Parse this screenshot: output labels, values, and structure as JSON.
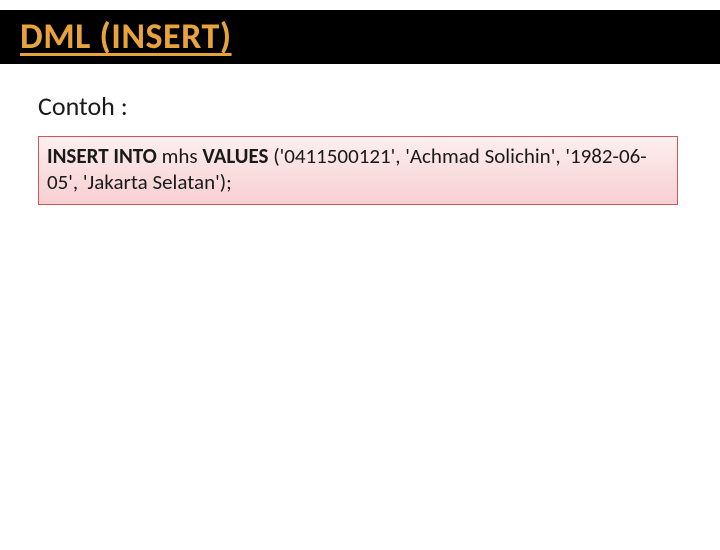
{
  "title": "DML (INSERT)",
  "subheading": "Contoh :",
  "sql": {
    "keyword_insert_into": "INSERT INTO",
    "table": "mhs",
    "keyword_values": "VALUES",
    "args": "('0411500121', 'Achmad Solichin', '1982-06-05', 'Jakarta Selatan');"
  }
}
